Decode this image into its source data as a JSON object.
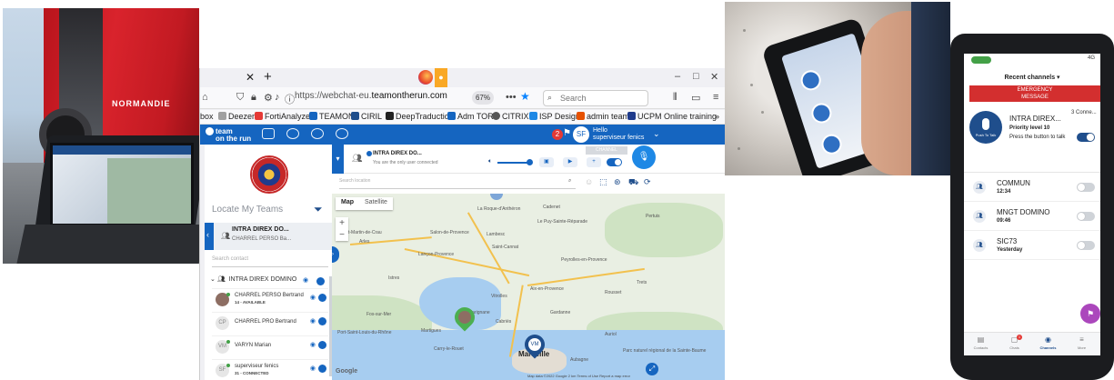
{
  "browser": {
    "url_prefix": "https://webchat-eu.",
    "url_domain": "teamontherun.com",
    "zoom": "67%",
    "search_placeholder": "Search",
    "bookmarks": [
      "box",
      "Deezer",
      "FortiAnalyzer",
      "TEAMON",
      "CIRIL",
      "DeepTraduction",
      "Adm TOR",
      "CITRIX",
      "ISP Design",
      "admin teams",
      "UCPM Online training"
    ],
    "more": "»"
  },
  "app": {
    "logo_line1": "team",
    "logo_line2": "on the run",
    "badge_count": "2",
    "avatar_initials": "SF",
    "hello": "Hello",
    "user_name": "superviseur fenics"
  },
  "left_panel": {
    "title": "Locate My Teams",
    "selected_title": "INTRA DIREX DO...",
    "selected_subtitle": "CHARREL PERSO Ba...",
    "search_placeholder": "Search contact",
    "group_name": "INTRA DIREX DOMINO",
    "contacts": [
      {
        "initials": "",
        "name": "CHARREL PERSO Bertrand",
        "status": "14 - AVAILABLE",
        "online": true
      },
      {
        "initials": "CP",
        "name": "CHARREL PRO Bertrand",
        "status": "",
        "online": false
      },
      {
        "initials": "VM",
        "name": "VARYN Marian",
        "status": "",
        "online": true
      },
      {
        "initials": "SF",
        "name": "superviseur fenics",
        "status": "31 - CONNECTED",
        "online": true
      }
    ]
  },
  "channel_bar": {
    "title": "INTRA DIREX DO...",
    "subtitle": "You are the only user connected",
    "channel_label": "CHANNEL"
  },
  "map": {
    "search_placeholder": "Search location",
    "tab_map": "Map",
    "tab_satellite": "Satellite",
    "zoom_in": "+",
    "zoom_out": "−",
    "marker_initials": "VM",
    "google": "Google",
    "attribution": "Map data ©2022 Google   2 km   Terms of Use   Report a map error",
    "labels": [
      {
        "text": "Marseille",
        "big": true
      },
      {
        "text": "Aix-en-Provence",
        "big": false
      },
      {
        "text": "Salon-de-Provence",
        "big": false
      },
      {
        "text": "Arles",
        "big": false
      },
      {
        "text": "Lambesc",
        "big": false
      },
      {
        "text": "Saint-Cannat",
        "big": false
      },
      {
        "text": "Pertuis",
        "big": false
      },
      {
        "text": "Lançon-Provence",
        "big": false
      },
      {
        "text": "Istres",
        "big": false
      },
      {
        "text": "Martigues",
        "big": false
      },
      {
        "text": "Marignane",
        "big": false
      },
      {
        "text": "Vitrolles",
        "big": false
      },
      {
        "text": "Gardanne",
        "big": false
      },
      {
        "text": "Fos-sur-Mer",
        "big": false
      },
      {
        "text": "Port-Saint-Louis-du-Rhône",
        "big": false
      },
      {
        "text": "Carry-le-Rouet",
        "big": false
      },
      {
        "text": "Cabriès",
        "big": false
      },
      {
        "text": "Cadenet",
        "big": false
      },
      {
        "text": "La Roque-d'Anthéron",
        "big": false
      },
      {
        "text": "Le Puy-Sainte-Réparade",
        "big": false
      },
      {
        "text": "Peyrolles-en-Provence",
        "big": false
      },
      {
        "text": "Saint-Martin-de-Crau",
        "big": false
      },
      {
        "text": "Rousset",
        "big": false
      },
      {
        "text": "Trets",
        "big": false
      },
      {
        "text": "Auriol",
        "big": false
      },
      {
        "text": "Aubagne",
        "big": false
      },
      {
        "text": "Parc naturel régional de la Sainte-Baume",
        "big": false
      },
      {
        "text": "Aubagne",
        "big": false
      }
    ]
  },
  "phone": {
    "signal": "4G",
    "recent_channels": "Recent channels ▾",
    "emergency_line1": "EMERGENCY",
    "emergency_line2": "MESSAGE",
    "active": {
      "ptt_label": "Push To Talk",
      "name": "INTRA DIREX...",
      "priority": "Priority level 10",
      "hint": "Press the button to talk",
      "connected": "3 Conne..."
    },
    "channels": [
      {
        "name": "COMMUN",
        "time": "12:34"
      },
      {
        "name": "MNGT DOMINO",
        "time": "09:46"
      },
      {
        "name": "SIC73",
        "time": "Yesterday"
      }
    ],
    "nav": [
      {
        "icon": "contacts-icon",
        "label": "Contacts"
      },
      {
        "icon": "chats-icon",
        "label": "Chats"
      },
      {
        "icon": "channels-icon",
        "label": "Channels"
      },
      {
        "icon": "more-icon",
        "label": "More"
      }
    ],
    "chats_badge": "1"
  },
  "photo1": {
    "bus_brand": "NORMANDIE"
  },
  "colors": {
    "brand_blue": "#1565c0",
    "emergency_red": "#d32f2f",
    "online_green": "#43a047"
  }
}
